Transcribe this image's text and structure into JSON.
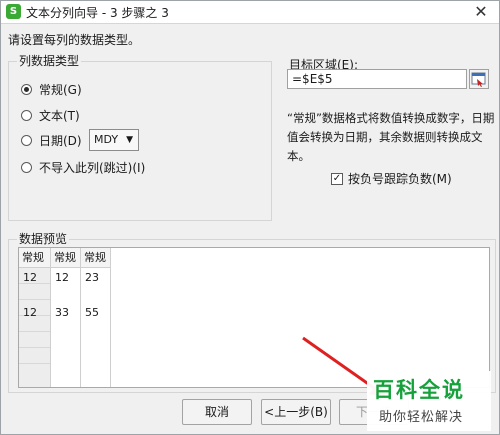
{
  "window": {
    "title": "文本分列向导 - 3 步骤之 3",
    "app_icon_letter": "S",
    "close_glyph": "✕"
  },
  "instruction": "请设置每列的数据类型。",
  "column_format": {
    "group_title": "列数据类型",
    "options": [
      {
        "label": "常规(G)",
        "checked": true
      },
      {
        "label": "文本(T)",
        "checked": false
      },
      {
        "label": "日期(D)",
        "checked": false
      },
      {
        "label": "不导入此列(跳过)(I)",
        "checked": false
      }
    ],
    "date_format": "MDY"
  },
  "destination": {
    "label": "目标区域(E):",
    "value": "=$E$5"
  },
  "description": "“常规”数据格式将数值转换成数字，日期值会转换为日期，其余数据则转换成文本。",
  "negative_option": {
    "label": "按负号跟踪负数(M)",
    "checked": true,
    "check_glyph": "✓"
  },
  "preview": {
    "group_title": "数据预览",
    "headers": [
      "常规",
      "常规",
      "常规"
    ],
    "rows": [
      [
        "12",
        "12",
        "23"
      ],
      [
        "12",
        "33",
        "55"
      ]
    ]
  },
  "buttons": {
    "cancel": "取消",
    "prev": "<上一步(B)",
    "next": "下一步"
  },
  "watermark": {
    "main": "百科全说",
    "sub": "助你轻松解决"
  },
  "colors": {
    "accent_red": "#e02020",
    "watermark_green": "#16a13b"
  }
}
